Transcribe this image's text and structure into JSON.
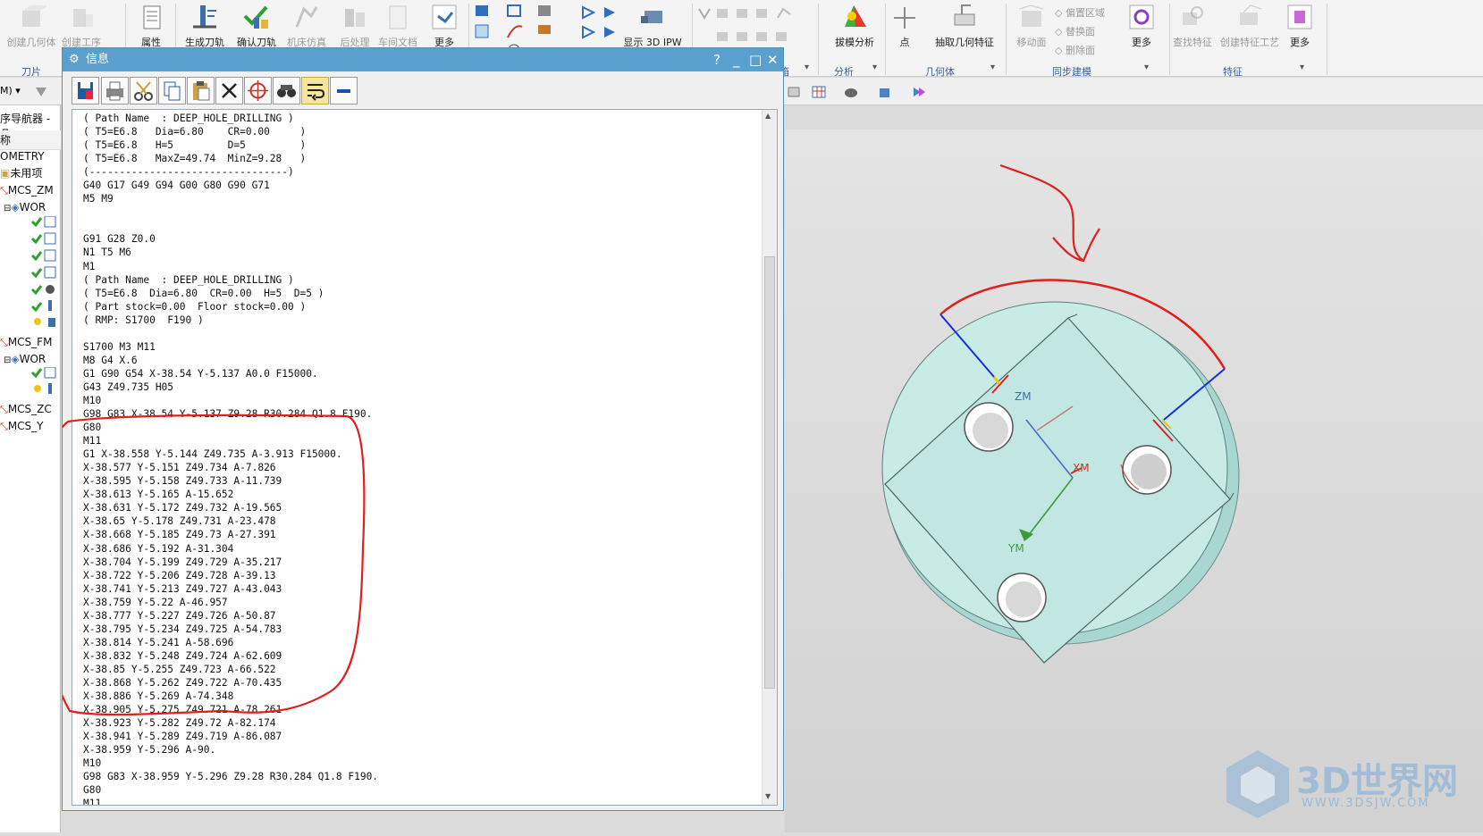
{
  "ribbon": {
    "buttons": [
      {
        "label": "创建几何体",
        "dim": true
      },
      {
        "label": "创建工序",
        "dim": true
      },
      {
        "label": "属性",
        "dim": false
      },
      {
        "label": "生成刀轨",
        "dim": false
      },
      {
        "label": "确认刀轨",
        "dim": false
      },
      {
        "label": "机床仿真",
        "dim": true
      },
      {
        "label": "后处理",
        "dim": true
      },
      {
        "label": "车间文档",
        "dim": true
      },
      {
        "label": "更多",
        "dim": false
      },
      {
        "label": "显示 3D IPW",
        "dim": false
      },
      {
        "label": "拔模分析",
        "dim": false
      },
      {
        "label": "点",
        "dim": false
      },
      {
        "label": "抽取几何特征",
        "dim": false
      },
      {
        "label": "移动面",
        "dim": true
      },
      {
        "label": "更多",
        "dim": false
      },
      {
        "label": "查找特征",
        "dim": true
      },
      {
        "label": "创建特征工艺",
        "dim": true
      },
      {
        "label": "更多",
        "dim": false
      }
    ],
    "small_labels": [
      "偏置区域",
      "替换面",
      "删除面"
    ],
    "groups": [
      "刀片",
      "分析",
      "几何体",
      "同步建模",
      "特征"
    ],
    "partial_group": "箱"
  },
  "nav": {
    "title_fragment": "序导航器 - 几",
    "column": "称",
    "rows": [
      "OMETRY",
      "未用项",
      "MCS_ZM",
      "WOR",
      "MCS_FM",
      "WOR",
      "MCS_ZC",
      "MCS_Y"
    ]
  },
  "dialog": {
    "title": "信息",
    "controls": {
      "help": "?",
      "minimize": "_",
      "maximize": "□",
      "close": "✕"
    },
    "text_lines": [
      "( Path Name  : DEEP_HOLE_DRILLING )",
      "( T5=E6.8   Dia=6.80    CR=0.00     )",
      "( T5=E6.8   H=5         D=5         )",
      "( T5=E6.8   MaxZ=49.74  MinZ=9.28   )",
      "(---------------------------------)",
      "G40 G17 G49 G94 G00 G80 G90 G71",
      "M5 M9",
      "",
      "",
      "G91 G28 Z0.0",
      "N1 T5 M6",
      "M1",
      "( Path Name  : DEEP_HOLE_DRILLING )",
      "( T5=E6.8  Dia=6.80  CR=0.00  H=5  D=5 )",
      "( Part stock=0.00  Floor stock=0.00 )",
      "( RMP: S1700  F190 )",
      "",
      "S1700 M3 M11",
      "M8 G4 X.6",
      "G1 G90 G54 X-38.54 Y-5.137 A0.0 F15000.",
      "G43 Z49.735 H05",
      "M10",
      "G98 G83 X-38.54 Y-5.137 Z9.28 R30.284 Q1.8 F190.",
      "G80",
      "M11",
      "G1 X-38.558 Y-5.144 Z49.735 A-3.913 F15000.",
      "X-38.577 Y-5.151 Z49.734 A-7.826",
      "X-38.595 Y-5.158 Z49.733 A-11.739",
      "X-38.613 Y-5.165 A-15.652",
      "X-38.631 Y-5.172 Z49.732 A-19.565",
      "X-38.65 Y-5.178 Z49.731 A-23.478",
      "X-38.668 Y-5.185 Z49.73 A-27.391",
      "X-38.686 Y-5.192 A-31.304",
      "X-38.704 Y-5.199 Z49.729 A-35.217",
      "X-38.722 Y-5.206 Z49.728 A-39.13",
      "X-38.741 Y-5.213 Z49.727 A-43.043",
      "X-38.759 Y-5.22 A-46.957",
      "X-38.777 Y-5.227 Z49.726 A-50.87",
      "X-38.795 Y-5.234 Z49.725 A-54.783",
      "X-38.814 Y-5.241 A-58.696",
      "X-38.832 Y-5.248 Z49.724 A-62.609",
      "X-38.85 Y-5.255 Z49.723 A-66.522",
      "X-38.868 Y-5.262 Z49.722 A-70.435",
      "X-38.886 Y-5.269 A-74.348",
      "X-38.905 Y-5.275 Z49.721 A-78.261",
      "X-38.923 Y-5.282 Z49.72 A-82.174",
      "X-38.941 Y-5.289 Z49.719 A-86.087",
      "X-38.959 Y-5.296 A-90.",
      "M10",
      "G98 G83 X-38.959 Y-5.296 Z9.28 R30.284 Q1.8 F190.",
      "G80",
      "M11"
    ]
  },
  "viewport": {
    "axis_labels": {
      "zm": "ZM",
      "xm": "XM",
      "ym": "YM"
    }
  },
  "watermark": {
    "text": "3D世界网",
    "sub": "WWW.3DSJW.COM"
  },
  "colors": {
    "accent": "#5aa0cf",
    "annotation": "#e0201c",
    "part": "#c8ebe6"
  }
}
